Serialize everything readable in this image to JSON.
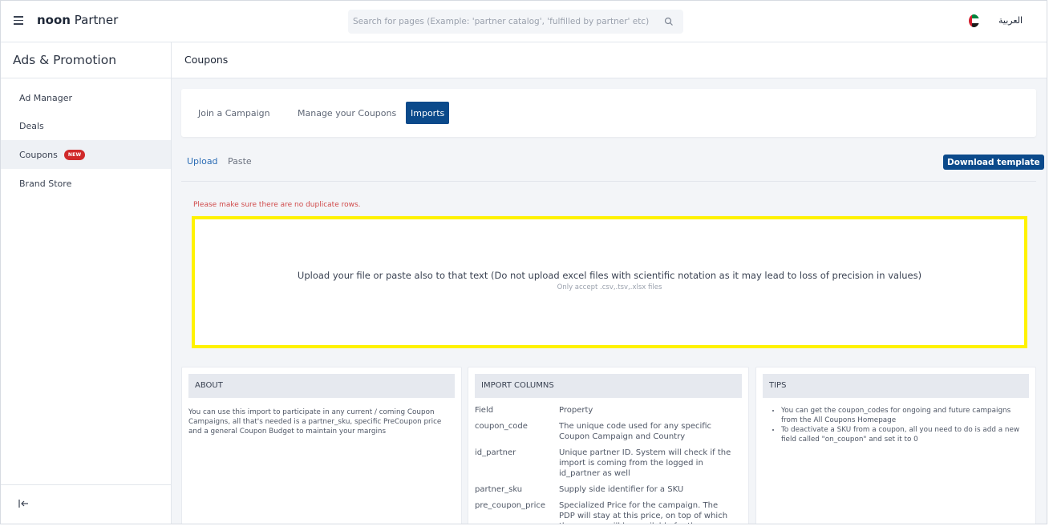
{
  "header": {
    "brand_bold": "noon",
    "brand_rest": "Partner",
    "search_placeholder": "Search for pages (Example: 'partner catalog', 'fulfilled by partner' etc)",
    "language": "العربية",
    "flag_icon": "uae-flag-icon"
  },
  "sidebar": {
    "title": "Ads & Promotion",
    "items": [
      {
        "label": "Ad Manager"
      },
      {
        "label": "Deals"
      },
      {
        "label": "Coupons",
        "badge": "NEW"
      },
      {
        "label": "Brand Store"
      }
    ],
    "collapse_icon": "collapse-left-icon"
  },
  "page": {
    "title": "Coupons",
    "tabs": [
      {
        "label": "Join a Campaign"
      },
      {
        "label": "Manage your Coupons"
      },
      {
        "label": "Imports"
      }
    ],
    "subtabs": [
      {
        "label": "Upload"
      },
      {
        "label": "Paste"
      }
    ],
    "download_label": "Download template",
    "warning": "Please make sure there are no duplicate rows.",
    "dropzone_main": "Upload your file or paste also to that text (Do not upload excel files with scientific notation as it may lead to loss of precision in values)",
    "dropzone_sub": "Only accept .csv,.tsv,.xlsx files"
  },
  "about": {
    "title": "ABOUT",
    "text": "You can use this import to participate in any current / coming Coupon Campaigns, all that's needed is a partner_sku, specific PreCoupon price and a general Coupon Budget to maintain your margins"
  },
  "import_columns": {
    "title": "IMPORT COLUMNS",
    "header_field": "Field",
    "header_property": "Property",
    "rows": [
      {
        "field": "coupon_code",
        "property": "The unique code used for any specific Coupon Campaign and Country"
      },
      {
        "field": "id_partner",
        "property": "Unique partner ID. System will check if the import is coming from the logged in id_partner as well"
      },
      {
        "field": "partner_sku",
        "property": "Supply side identifier for a SKU"
      },
      {
        "field": "pre_coupon_price",
        "property": "Specialized Price for the campaign. The PDP will stay at this price, on top of which the coupon will be available for the customers"
      }
    ]
  },
  "tips": {
    "title": "TIPS",
    "items": [
      "You can get the coupon_codes for ongoing and future campaigns from the All Coupons Homepage",
      "To deactivate a SKU from a coupon, all you need to do is add a new field called \"on_coupon\" and set it to 0"
    ]
  },
  "colors": {
    "primary": "#0b4a8b",
    "badge": "#d02a2a",
    "highlight": "#fff200",
    "warning": "#d04a4a"
  }
}
